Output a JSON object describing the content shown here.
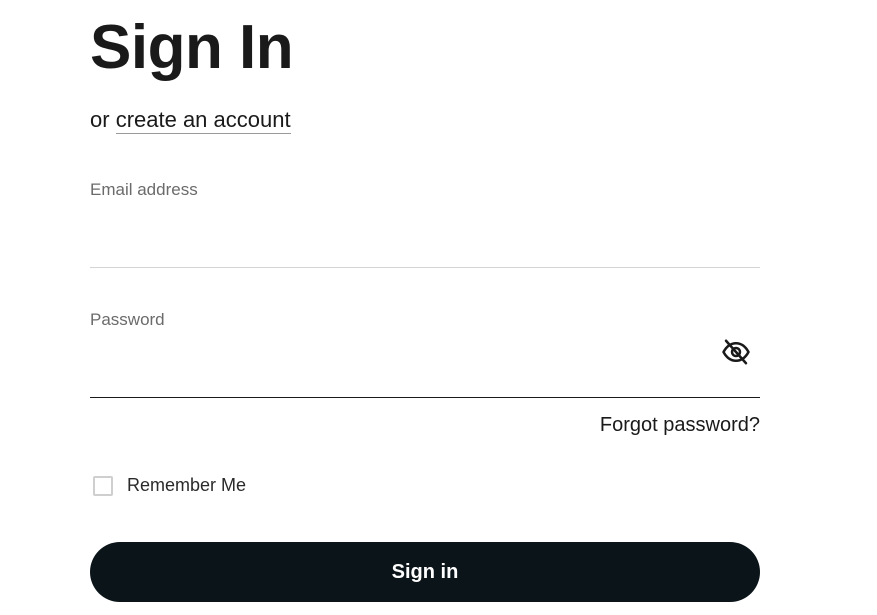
{
  "title": "Sign In",
  "subtitle": {
    "prefix": "or",
    "link_label": "create an account"
  },
  "email": {
    "label": "Email address",
    "value": ""
  },
  "password": {
    "label": "Password",
    "value": "",
    "toggle_icon": "eye-off-icon"
  },
  "forgot_label": "Forgot password?",
  "remember": {
    "label": "Remember Me",
    "checked": false
  },
  "submit_label": "Sign in",
  "colors": {
    "button_bg": "#0b1418",
    "button_text": "#ffffff",
    "text": "#1a1a1a",
    "muted_label": "#6b6b6b",
    "divider": "#d4d4d4"
  }
}
